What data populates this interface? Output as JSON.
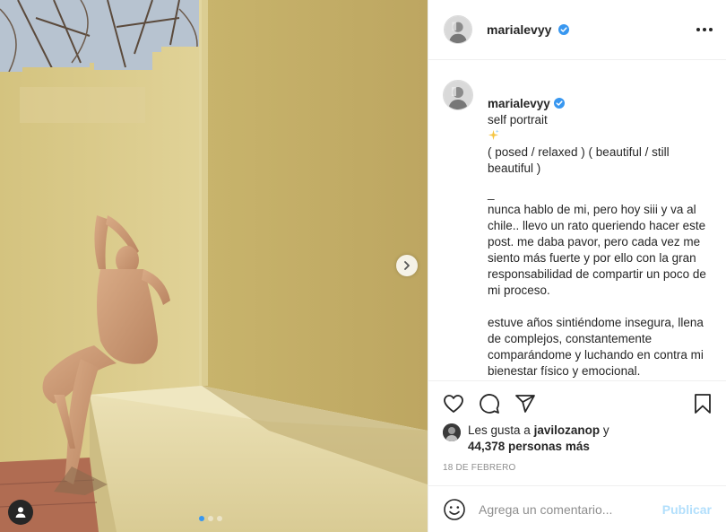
{
  "post": {
    "username": "marialevyy",
    "verified": true,
    "caption_title": "self portrait",
    "caption_subtitle": "( posed / relaxed ) ( beautiful / still beautiful )",
    "caption_dash": "_",
    "caption_paragraph_1": "nunca hablo de mi, pero hoy siii y va al chile.. llevo un rato queriendo hacer este post. me daba pavor, pero cada vez me siento más fuerte y por ello con la gran responsabilidad de compartir un poco de mi proceso.",
    "caption_paragraph_2": "estuve años sintiéndome insegura, llena de complejos, constantemente comparándome y luchando en contra mi bienestar físico y emocional.\nsin importar como me viera, nunca me sentía tranquila y siempre estaba inconforme."
  },
  "likes": {
    "prefix": "Les gusta a",
    "liker": "javilozanop",
    "conjunction": "y",
    "others": "44,378 personas más"
  },
  "date": "18 DE FEBRERO",
  "comment_box": {
    "placeholder": "Agrega un comentario...",
    "publish_label": "Publicar"
  },
  "carousel": {
    "slide_count": 3,
    "active_index": 0
  },
  "colors": {
    "verified_blue": "#3897f0",
    "publish_disabled": "#b2dffc",
    "wall_yellow": "#d8c98d",
    "meta_grey": "#8e8e8e"
  },
  "icons": [
    "more-options-icon",
    "heart-icon",
    "comment-icon",
    "share-icon",
    "bookmark-icon",
    "emoji-icon",
    "chevron-right-icon",
    "user-tag-icon",
    "verified-badge-icon",
    "sparkles-icon"
  ]
}
